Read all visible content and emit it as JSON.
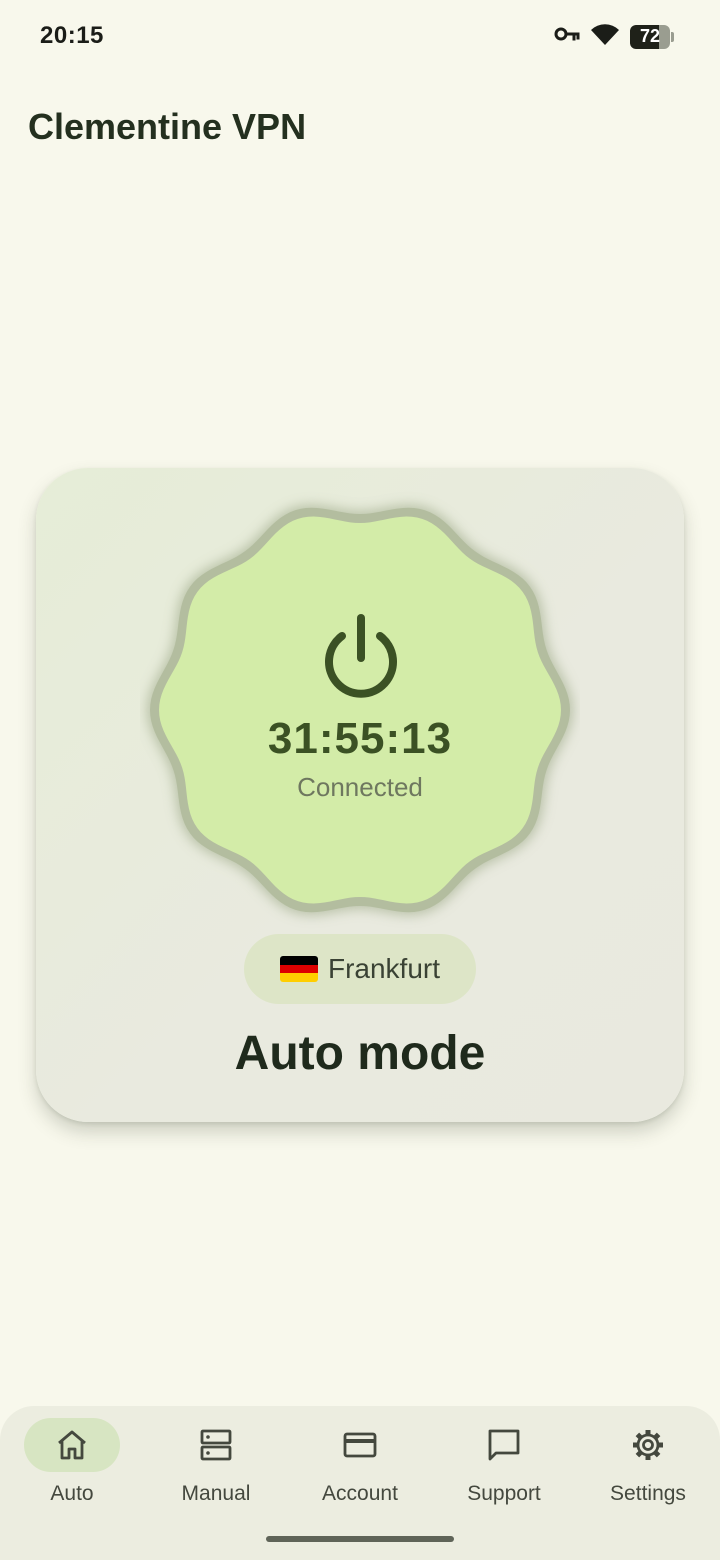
{
  "status_bar": {
    "time": "20:15",
    "icons": [
      "vpn-key-icon",
      "wifi-icon",
      "battery-icon"
    ],
    "battery_level": "72"
  },
  "app": {
    "title": "Clementine VPN"
  },
  "main_card": {
    "timer": "31:55:13",
    "status": "Connected",
    "location": {
      "name": "Frankfurt",
      "flag_icon": "germany-flag-icon",
      "flag_colors": [
        "#000000",
        "#dd0000",
        "#ffce00"
      ]
    },
    "mode": "Auto mode"
  },
  "nav": {
    "items": [
      {
        "label": "Auto",
        "icon": "home-icon",
        "active": true
      },
      {
        "label": "Manual",
        "icon": "server-list-icon",
        "active": false
      },
      {
        "label": "Account",
        "icon": "credit-card-icon",
        "active": false
      },
      {
        "label": "Support",
        "icon": "chat-bubble-icon",
        "active": false
      },
      {
        "label": "Settings",
        "icon": "gear-icon",
        "active": false
      }
    ]
  },
  "colors": {
    "background": "#f8f8ec",
    "blob_fill": "#d3eca8",
    "blob_ring": "#a9b495",
    "accent_dark": "#3b5124",
    "nav_active_pill": "#d7e5c2"
  }
}
